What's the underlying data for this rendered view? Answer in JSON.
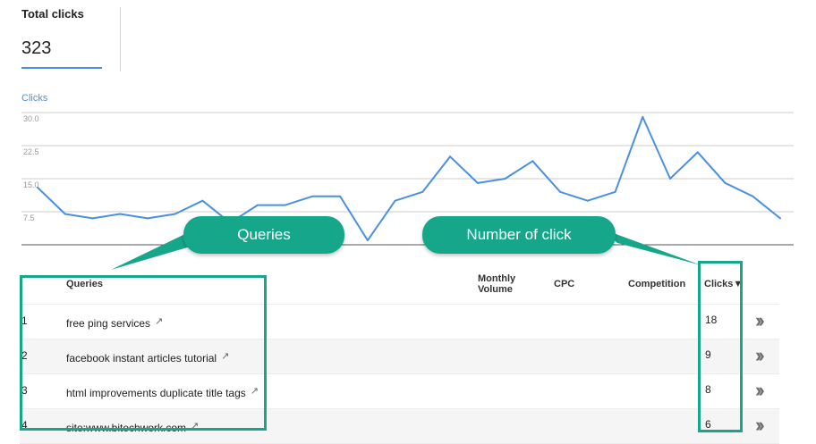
{
  "summary": {
    "title": "Total clicks",
    "value": "323"
  },
  "colors": {
    "accent": "#4a90e2",
    "callout": "#16a78b",
    "grid": "#cccccc",
    "baseline": "#555555"
  },
  "chart_data": {
    "type": "line",
    "series": [
      {
        "name": "Clicks",
        "values": [
          13,
          7,
          6,
          7,
          6,
          7,
          10,
          5,
          9,
          9,
          11,
          11,
          1,
          10,
          12,
          20,
          14,
          15,
          19,
          12,
          10,
          12,
          29,
          15,
          21,
          14,
          11,
          6
        ]
      }
    ],
    "yticks": [
      "30.0",
      "22.5",
      "15.0",
      "7.5"
    ],
    "ylim": [
      0,
      30
    ],
    "grid": true
  },
  "table": {
    "columns": {
      "queries": "Queries",
      "volume_line1": "Monthly",
      "volume_line2": "Volume",
      "cpc": "CPC",
      "competition": "Competition",
      "clicks": "Clicks",
      "sort_indicator": "▼"
    },
    "rows": [
      {
        "rank": "1",
        "query": "free ping services",
        "clicks": "18"
      },
      {
        "rank": "2",
        "query": "facebook instant articles tutorial",
        "clicks": "9"
      },
      {
        "rank": "3",
        "query": "html improvements duplicate title tags",
        "clicks": "8"
      },
      {
        "rank": "4",
        "query": "site:www.bitechwork.com",
        "clicks": "6"
      }
    ],
    "external_link_icon": "external-link-icon",
    "expand_icon": "double-chevron-right-icon"
  },
  "annotations": {
    "queries_label": "Queries",
    "clicks_label": "Number of click"
  }
}
